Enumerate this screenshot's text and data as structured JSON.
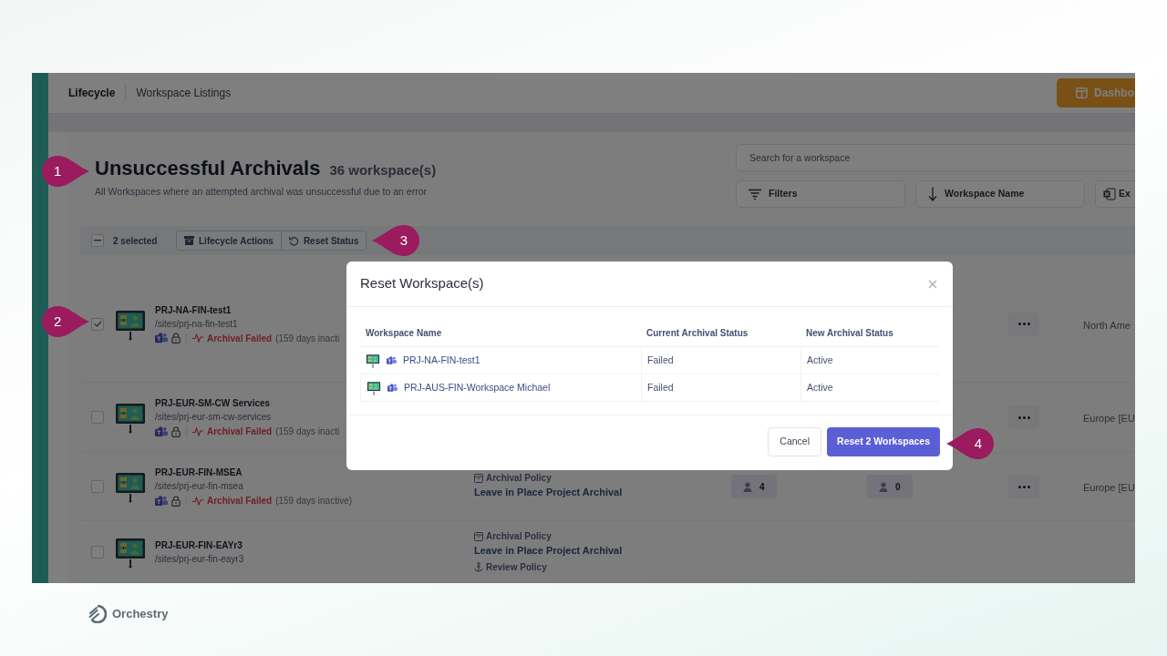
{
  "brand": {
    "name": "Orchestry"
  },
  "breadcrumb": [
    {
      "label": "Lifecycle"
    },
    {
      "label": "Workspace Listings"
    }
  ],
  "dashboard_button": {
    "label": "Dashbo"
  },
  "header": {
    "title": "Unsuccessful Archivals",
    "count": "36 workspace(s)",
    "subtitle": "All Workspaces where an attempted archival was unsuccessful due to an error"
  },
  "search": {
    "placeholder": "Search for a workspace"
  },
  "tools": [
    {
      "kind": "filter",
      "label": "Filters"
    },
    {
      "kind": "sort",
      "label": "Workspace Name"
    },
    {
      "kind": "export",
      "label": "Ex"
    }
  ],
  "selection": {
    "indeterminate": true,
    "count": "2 selected",
    "actions": [
      {
        "kind": "archive",
        "label": "Lifecycle Actions"
      },
      {
        "kind": "reset",
        "label": "Reset Status"
      }
    ]
  },
  "rows": [
    {
      "checked": true,
      "name": "PRJ-NA-FIN-test1",
      "path": "/sites/prj-na-fin-test1",
      "status": "Archival Failed",
      "inactive": "(159 days inacti",
      "menu": true,
      "region": "North Ame"
    },
    {
      "checked": false,
      "name": "PRJ-EUR-SM-CW Services",
      "path": "/sites/prj-eur-sm-cw-services",
      "status": "Archival Failed",
      "inactive": "(159 days inacti",
      "menu": true,
      "region": "Europe [EU"
    },
    {
      "checked": false,
      "name": "PRJ-EUR-FIN-MSEA",
      "path": "/sites/prj-eur-fin-msea",
      "status": "Archival Failed",
      "inactive": "(159 days inactive)",
      "policies": [
        {
          "kind": "archival",
          "label": "Archival Policy",
          "value": "Leave in Place Project Archival"
        }
      ],
      "owners": "4",
      "members": "0",
      "menu": true,
      "region": "Europe [EU"
    },
    {
      "checked": false,
      "name": "PRJ-EUR-FIN-EAYr3",
      "path": "/sites/prj-eur-fin-eayr3",
      "policies": [
        {
          "kind": "archival",
          "label": "Archival Policy",
          "value": "Leave in Place Project Archival"
        },
        {
          "kind": "review",
          "label": "Review Policy"
        }
      ]
    }
  ],
  "modal": {
    "title": "Reset Workspace(s)",
    "columns": [
      "Workspace Name",
      "Current Archival Status",
      "New Archival Status"
    ],
    "rows": [
      {
        "name": "PRJ-NA-FIN-test1",
        "current": "Failed",
        "new": "Active"
      },
      {
        "name": "PRJ-AUS-FIN-Workspace Michael",
        "current": "Failed",
        "new": "Active"
      }
    ],
    "buttons": [
      {
        "kind": "secondary",
        "label": "Cancel"
      },
      {
        "kind": "primary",
        "label": "Reset 2 Workspaces"
      }
    ]
  },
  "callouts": [
    "1",
    "2",
    "3",
    "4"
  ]
}
